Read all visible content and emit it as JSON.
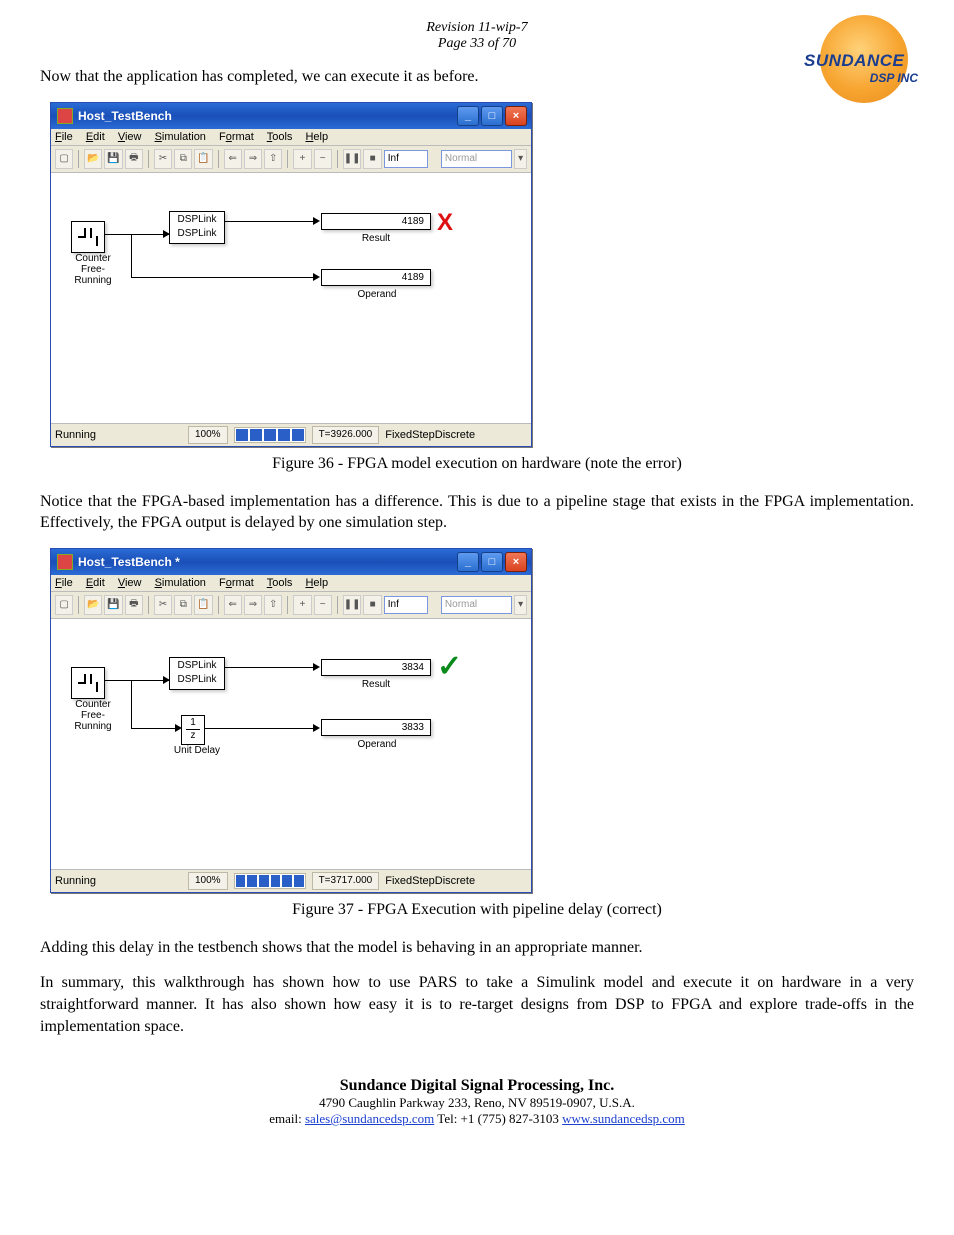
{
  "header": {
    "revision": "Revision 11-wip-7",
    "page": "Page 33 of 70"
  },
  "logo": {
    "line1": "SUNDANCE",
    "line2": "DSP INC"
  },
  "para1": "Now that the application has completed, we can execute it as before.",
  "fig36": {
    "title": "Host_TestBench",
    "menu": {
      "file": "File",
      "edit": "Edit",
      "view": "View",
      "simulation": "Simulation",
      "format": "Format",
      "tools": "Tools",
      "help": "Help"
    },
    "toolbar": {
      "inf": "Inf",
      "normal": "Normal"
    },
    "blocks": {
      "counter1": "Counter",
      "counter2": "Free-Running",
      "dsplink1": "DSPLink",
      "dsplink2": "DSPLink",
      "result": "Result",
      "operand": "Operand",
      "result_val": "4189",
      "operand_val": "4189"
    },
    "status": {
      "running": "Running",
      "pct": "100%",
      "time": "T=3926.000",
      "solver": "FixedStepDiscrete"
    },
    "caption": "Figure 36 - FPGA model execution on hardware (note the error)"
  },
  "para2": "Notice that the FPGA-based implementation has a difference.  This is due to a pipeline stage that exists in the FPGA implementation.  Effectively, the FPGA output is delayed by one simulation step.",
  "fig37": {
    "title": "Host_TestBench *",
    "menu": {
      "file": "File",
      "edit": "Edit",
      "view": "View",
      "simulation": "Simulation",
      "format": "Format",
      "tools": "Tools",
      "help": "Help"
    },
    "toolbar": {
      "inf": "Inf",
      "normal": "Normal"
    },
    "blocks": {
      "counter1": "Counter",
      "counter2": "Free-Running",
      "dsplink1": "DSPLink",
      "dsplink2": "DSPLink",
      "unitdelay_top": "1",
      "unitdelay_bot": "z",
      "unitdelay": "Unit Delay",
      "result": "Result",
      "operand": "Operand",
      "result_val": "3834",
      "operand_val": "3833"
    },
    "status": {
      "running": "Running",
      "pct": "100%",
      "time": "T=3717.000",
      "solver": "FixedStepDiscrete"
    },
    "caption": "Figure 37 - FPGA Execution with pipeline delay (correct)"
  },
  "para3": "Adding this delay in the testbench shows that the model is behaving in an appropriate manner.",
  "para4": "In summary, this walkthrough has shown how to use PARS to take a Simulink model and execute it on hardware in a very straightforward manner.  It has also shown how easy it is to re-target designs from DSP to FPGA and explore trade-offs in the implementation space.",
  "footer": {
    "company": "Sundance Digital Signal Processing, Inc.",
    "addr": "4790 Caughlin Parkway 233, Reno, NV 89519-0907, U.S.A.",
    "email_label": "email: ",
    "email": "sales@sundancedsp.com",
    "tel": " Tel: +1 (775) 827-3103  ",
    "url": "www.sundancedsp.com"
  }
}
